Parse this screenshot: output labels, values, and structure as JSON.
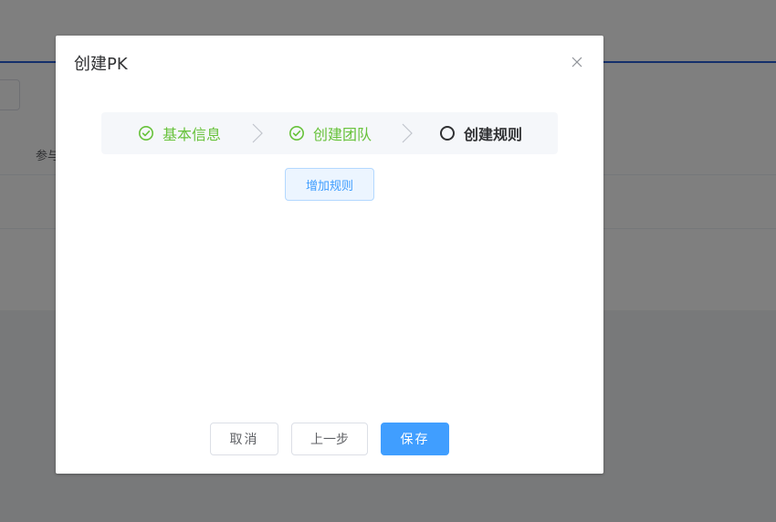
{
  "background": {
    "button_fragment": "",
    "column_header": "参与"
  },
  "dialog": {
    "title": "创建PK",
    "close_icon": "close-icon"
  },
  "steps": [
    {
      "label": "基本信息",
      "status": "success",
      "icon": "check-circle-icon"
    },
    {
      "label": "创建团队",
      "status": "success",
      "icon": "check-circle-icon"
    },
    {
      "label": "创建规则",
      "status": "active",
      "icon": "circle-icon"
    }
  ],
  "actions": {
    "add_rule_label": "增加规则"
  },
  "footer": {
    "cancel_label": "取消",
    "prev_label": "上一步",
    "save_label": "保存"
  },
  "colors": {
    "primary": "#409eff",
    "success": "#67c23a",
    "text": "#303133"
  }
}
